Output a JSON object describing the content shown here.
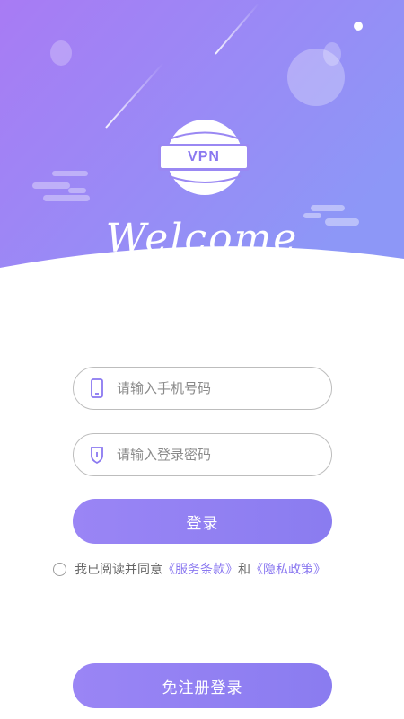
{
  "hero": {
    "badge_text": "VPN",
    "welcome_text": "Welcome",
    "gradient_start": "#a07cf4",
    "gradient_end": "#8f97f7"
  },
  "login_form": {
    "phone_placeholder": "请输入手机号码",
    "password_placeholder": "请输入登录密码",
    "login_button": "登录"
  },
  "agreement": {
    "prefix": "我已阅读并同意",
    "terms_link": "《服务条款》",
    "connector": "和",
    "privacy_link": "《隐私政策》"
  },
  "footer": {
    "register_login_button": "免注册登录"
  }
}
